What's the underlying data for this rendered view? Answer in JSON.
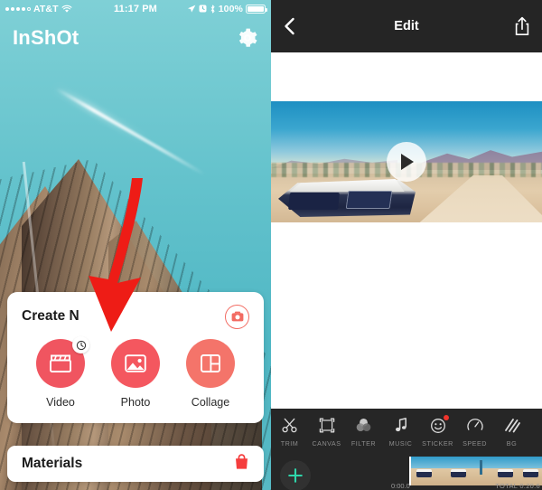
{
  "left_screen": {
    "status_bar": {
      "carrier": "AT&T",
      "time": "11:17 PM",
      "battery_percent": "100%",
      "signal_icon": "signal-dots-icon",
      "wifi_icon": "wifi-icon",
      "location_icon": "location-arrow-icon",
      "alarm_icon": "alarm-icon",
      "bluetooth_icon": "bluetooth-icon",
      "battery_icon": "battery-full-icon"
    },
    "app_header": {
      "brand": "InShOt",
      "settings_icon": "gear-icon"
    },
    "create_panel": {
      "title": "Create N",
      "camera_icon": "camera-icon",
      "actions": [
        {
          "label": "Video",
          "icon": "clapperboard-icon",
          "color": "#f05560",
          "badge_icon": "clock-icon"
        },
        {
          "label": "Photo",
          "icon": "image-icon",
          "color": "#f4575f",
          "badge_icon": ""
        },
        {
          "label": "Collage",
          "icon": "grid-layout-icon",
          "color": "#f4746a",
          "badge_icon": ""
        }
      ]
    },
    "materials_row": {
      "label": "Materials",
      "icon": "shopping-bag-icon"
    },
    "annotation": {
      "arrow_icon": "red-arrow-icon",
      "color": "#ee1c16"
    }
  },
  "right_screen": {
    "header": {
      "title": "Edit",
      "back_icon": "chevron-left-icon",
      "share_icon": "share-upload-icon"
    },
    "preview": {
      "play_icon": "play-icon"
    },
    "toolbar": [
      {
        "label": "TRIM",
        "icon": "scissors-icon",
        "badge": false
      },
      {
        "label": "CANVAS",
        "icon": "crop-frame-icon",
        "badge": false
      },
      {
        "label": "FILTER",
        "icon": "color-circles-icon",
        "badge": false
      },
      {
        "label": "MUSIC",
        "icon": "music-note-icon",
        "badge": false
      },
      {
        "label": "STICKER",
        "icon": "smiley-icon",
        "badge": true
      },
      {
        "label": "SPEED",
        "icon": "speedometer-icon",
        "badge": false
      },
      {
        "label": "BG",
        "icon": "diagonal-stripes-icon",
        "badge": false
      },
      {
        "label": "",
        "icon": "partial-icon",
        "badge": false
      }
    ],
    "timeline": {
      "add_icon": "plus-icon",
      "add_color": "#2fd6ab",
      "start_time": "0:00.0",
      "total_time": "TOTAL 0:20.6"
    }
  },
  "colors": {
    "teal_bg": "#63c4cd",
    "coral": "#f05560",
    "dark_chrome": "#262626",
    "accent_green": "#2fd6ab",
    "annotation_red": "#ee1c16"
  }
}
